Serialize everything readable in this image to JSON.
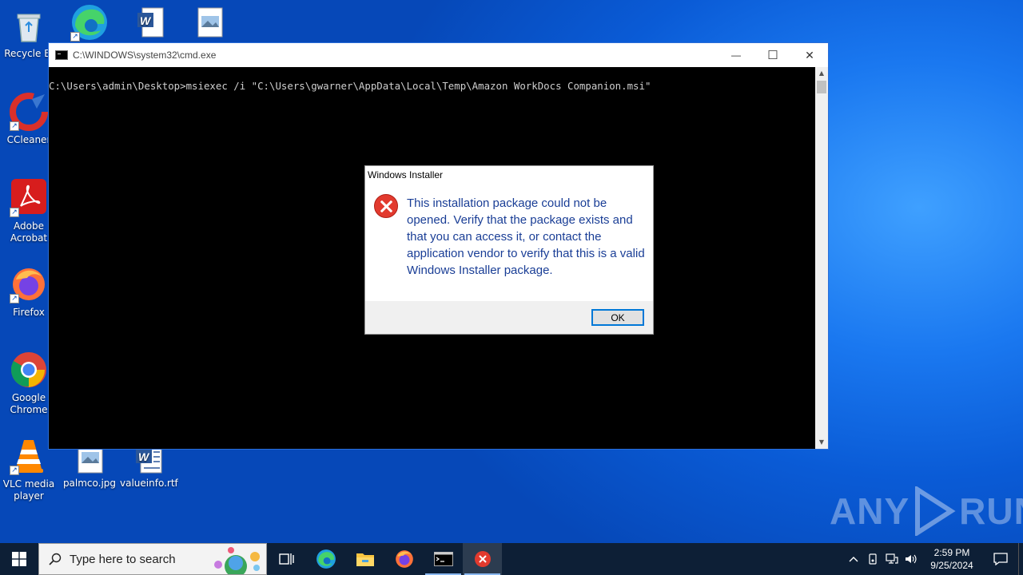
{
  "desktop": {
    "icons": [
      {
        "label": "Recycle Bin",
        "icon": "recycle-bin-icon"
      },
      {
        "label": "CCleaner",
        "icon": "ccleaner-icon"
      },
      {
        "label": "Adobe Acrobat",
        "icon": "adobe-acrobat-icon"
      },
      {
        "label": "Firefox",
        "icon": "firefox-icon"
      },
      {
        "label": "Google Chrome",
        "icon": "chrome-icon"
      },
      {
        "label": "VLC media player",
        "icon": "vlc-icon"
      },
      {
        "label": "palmco.jpg",
        "icon": "image-file-icon"
      },
      {
        "label": "valueinfo.rtf",
        "icon": "word-document-icon"
      }
    ],
    "recycle_label": "Recycle Bi",
    "ccleaner_label": "CCleaner",
    "acrobat_label": "Adobe\nAcrobat",
    "firefox_label": "Firefox",
    "chrome_label": "Google\nChrome",
    "vlc_label": "VLC media\nplayer",
    "palmco_label": "palmco.jpg",
    "valueinfo_label": "valueinfo.rtf"
  },
  "cmd": {
    "title": "C:\\WINDOWS\\system32\\cmd.exe",
    "line1": "C:\\Users\\admin\\Desktop>msiexec /i \"C:\\Users\\gwarner\\AppData\\Local\\Temp\\Amazon WorkDocs Companion.msi\"",
    "minimize": "—",
    "maximize": "☐",
    "close": "✕"
  },
  "dialog": {
    "title": "Windows Installer",
    "message": "This installation package could not be opened.  Verify that the package exists and that you can access it, or contact the application vendor to verify that this is a valid Windows Installer package.",
    "ok_label": "OK",
    "icon": "error-icon"
  },
  "watermark": {
    "left": "ANY",
    "right": "RUN"
  },
  "taskbar": {
    "search_placeholder": "Type here to search",
    "time": "2:59 PM",
    "date": "9/25/2024",
    "colors": {
      "background": "#0d1f36",
      "accent": "#0078d7"
    }
  }
}
